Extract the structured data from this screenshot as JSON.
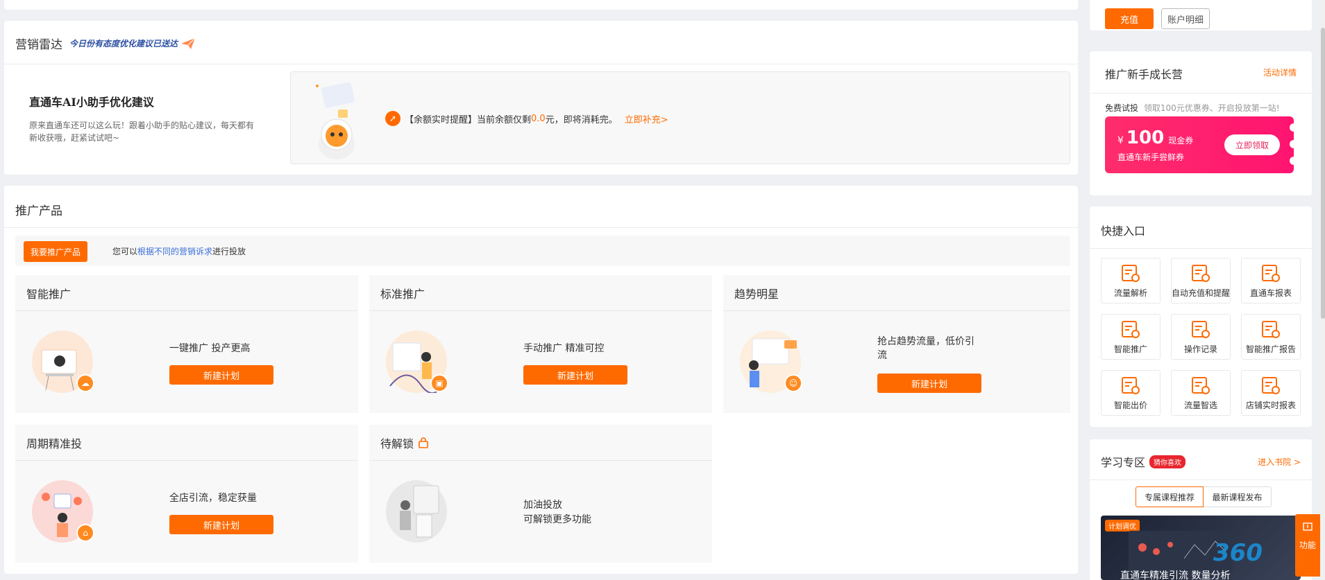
{
  "top_account": {
    "recharge_label": "充值",
    "detail_label": "账户明细"
  },
  "radar": {
    "title": "营销雷达",
    "subtitle": "今日份有态度优化建议已送达",
    "ai_title": "直通车AI小助手优化建议",
    "ai_desc": "原来直通车还可以这么玩！跟着小助手的贴心建议，每天都有新收获哦，赶紧试试吧~",
    "alert_prefix": "【余额实时提醒】当前余额仅剩",
    "alert_amount": "0.0",
    "alert_suffix": "元，即将消耗完。",
    "alert_link": "立即补充>"
  },
  "products": {
    "title": "推广产品",
    "promote_btn": "我要推广产品",
    "hint_prefix": "您可以",
    "hint_link": "根据不同的营销诉求",
    "hint_suffix": "进行投放",
    "items": [
      {
        "name": "智能推广",
        "desc": "一键推广 投产更高",
        "btn": "新建计划"
      },
      {
        "name": "标准推广",
        "desc": "手动推广 精准可控",
        "btn": "新建计划"
      },
      {
        "name": "趋势明星",
        "desc": "抢占趋势流量，低价引流",
        "btn": "新建计划"
      },
      {
        "name": "周期精准投",
        "desc": "全店引流，稳定获量",
        "btn": "新建计划"
      },
      {
        "name": "待解锁",
        "desc1": "加油投放",
        "desc2": "可解锁更多功能"
      }
    ]
  },
  "growth": {
    "title": "推广新手成长营",
    "detail_link": "活动详情",
    "trial_label": "免费试投",
    "trial_desc": "领取100元优惠券、开启投放第一站!",
    "coupon_currency": "¥",
    "coupon_amount": "100",
    "coupon_unit": "现金券",
    "coupon_desc": "直通车新手尝鲜券",
    "coupon_btn": "立即领取"
  },
  "quick": {
    "title": "快捷入口",
    "items": [
      {
        "label": "流量解析",
        "icon": "traffic-analysis-icon"
      },
      {
        "label": "自动充值和提醒",
        "icon": "auto-recharge-icon"
      },
      {
        "label": "直通车报表",
        "icon": "report-icon"
      },
      {
        "label": "智能推广",
        "icon": "smart-promo-icon"
      },
      {
        "label": "操作记录",
        "icon": "operation-log-icon"
      },
      {
        "label": "智能推广报告",
        "icon": "smart-report-icon"
      },
      {
        "label": "智能出价",
        "icon": "smart-bid-icon"
      },
      {
        "label": "流量智选",
        "icon": "traffic-select-icon"
      },
      {
        "label": "店铺实时报表",
        "icon": "shop-report-icon"
      }
    ]
  },
  "learn": {
    "title": "学习专区",
    "tag": "猜你喜欢",
    "link": "进入书院 >",
    "tab1": "专属课程推荐",
    "tab2": "最新课程发布",
    "banner_tag": "计划调优",
    "banner_title": "直通车精准引流 数量分析",
    "float_label": "功能"
  },
  "watermark": "360"
}
